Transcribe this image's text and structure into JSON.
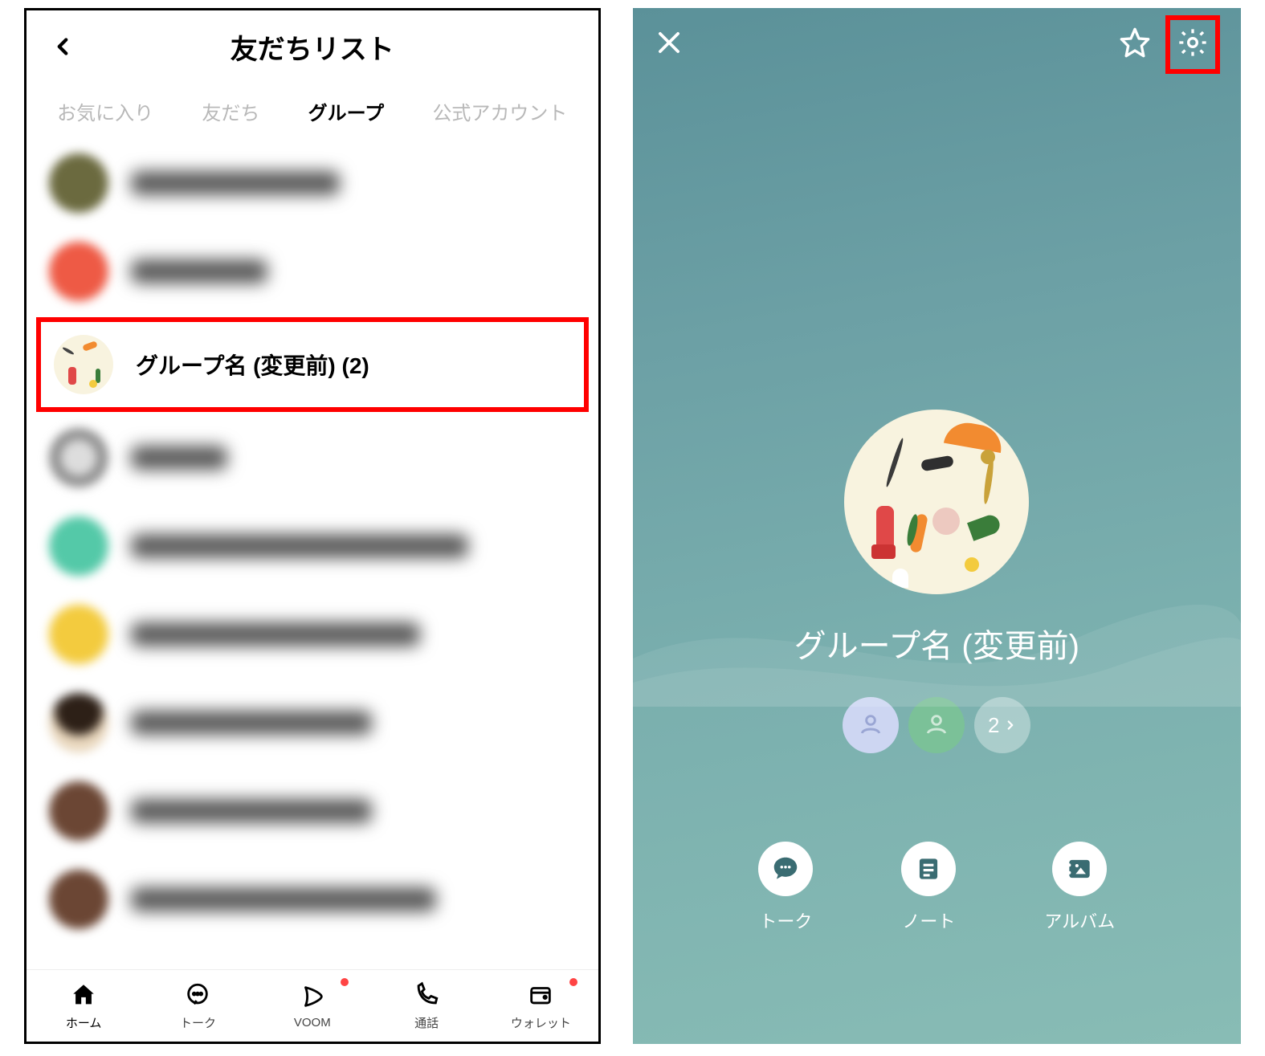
{
  "left": {
    "title": "友だちリスト",
    "tabs": [
      "お気に入り",
      "友だち",
      "グループ",
      "公式アカウント"
    ],
    "active_tab_index": 2,
    "highlight_row": {
      "label": "グループ名 (変更前)  (2)"
    },
    "blurred_rows": [
      {
        "avatar_color": "#6b6a3f",
        "name_width": 260
      },
      {
        "avatar_color": "#ee5a45",
        "name_width": 170
      },
      {
        "avatar_color": "#8f8f8f",
        "name_width": 120
      },
      {
        "avatar_color": "#54c9a8",
        "name_width": 420
      },
      {
        "avatar_color": "#f3cb3e",
        "name_width": 360
      },
      {
        "avatar_color": "#2d2017",
        "name_width": 300
      },
      {
        "avatar_color": "#6b4634",
        "name_width": 300
      },
      {
        "avatar_color": "#6b4634",
        "name_width": 380
      }
    ],
    "bottom_nav": [
      {
        "label": "ホーム",
        "icon": "home",
        "active": true,
        "dot": false
      },
      {
        "label": "トーク",
        "icon": "chat",
        "active": false,
        "dot": false
      },
      {
        "label": "VOOM",
        "icon": "play",
        "active": false,
        "dot": true
      },
      {
        "label": "通話",
        "icon": "phone",
        "active": false,
        "dot": false
      },
      {
        "label": "ウォレット",
        "icon": "wallet",
        "active": false,
        "dot": true
      }
    ]
  },
  "right": {
    "group_name": "グループ名 (変更前)",
    "member_chips": [
      {
        "type": "avatar",
        "color": "#cdd6f2"
      },
      {
        "type": "avatar",
        "color": "#7bc198"
      },
      {
        "type": "count",
        "value": "2"
      }
    ],
    "actions": [
      {
        "label": "トーク",
        "icon": "chat-filled"
      },
      {
        "label": "ノート",
        "icon": "note"
      },
      {
        "label": "アルバム",
        "icon": "album"
      }
    ],
    "bg_colors": {
      "top": "#5b9199",
      "bottom": "#88bcb5"
    }
  }
}
